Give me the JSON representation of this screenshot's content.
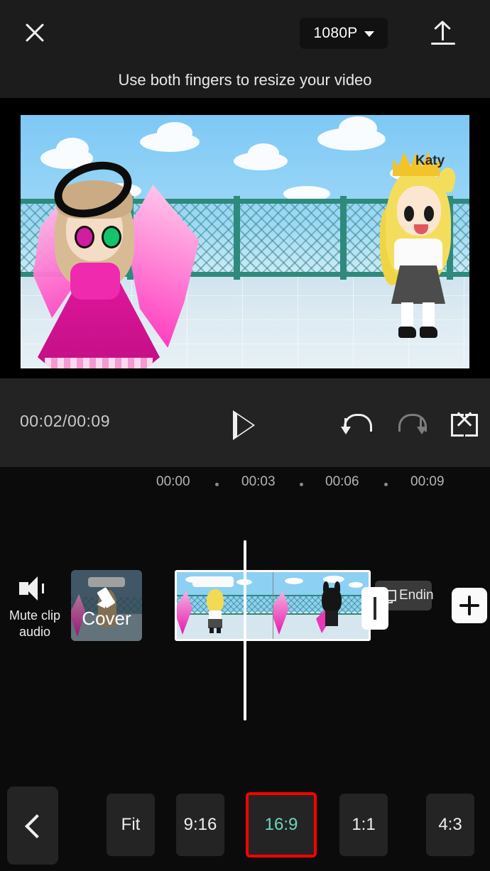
{
  "topbar": {
    "close_icon": "close-icon",
    "resolution": "1080P",
    "resolution_caret": "chevron-down-icon",
    "export_icon": "upload-icon"
  },
  "hint": {
    "text": "Use both fingers to resize your video"
  },
  "preview": {
    "character_left_name": "",
    "character_right_label": "Katy"
  },
  "player": {
    "current_time": "00:02/00:09",
    "play_icon": "play-icon",
    "undo_icon": "undo-icon",
    "redo_icon": "redo-icon",
    "fullscreen_icon": "fullscreen-icon"
  },
  "ruler": {
    "ticks": [
      "00:00",
      "00:03",
      "00:06",
      "00:09"
    ]
  },
  "timeline": {
    "mute_icon": "speaker-mute-icon",
    "mute_label_line1": "Mute clip",
    "mute_label_line2": "audio",
    "cover_icon": "pencil-icon",
    "cover_label": "Cover",
    "ending_icon": "ending-card-icon",
    "ending_label": "Endin",
    "trim_handle": "trim-handle",
    "add_icon": "plus-icon",
    "playhead": "playhead"
  },
  "bottombar": {
    "back_icon": "chevron-left-icon",
    "ratios": [
      {
        "label": "Fit",
        "selected": false
      },
      {
        "label": "9:16",
        "selected": false
      },
      {
        "label": "16:9",
        "selected": true
      },
      {
        "label": "1:1",
        "selected": false
      },
      {
        "label": "4:3",
        "selected": false
      }
    ]
  },
  "colors": {
    "accent_selected_border": "#ff0000",
    "accent_selected_text": "#6fd5bc",
    "panel": "#1c1c1c",
    "background": "#0b0b0b"
  }
}
